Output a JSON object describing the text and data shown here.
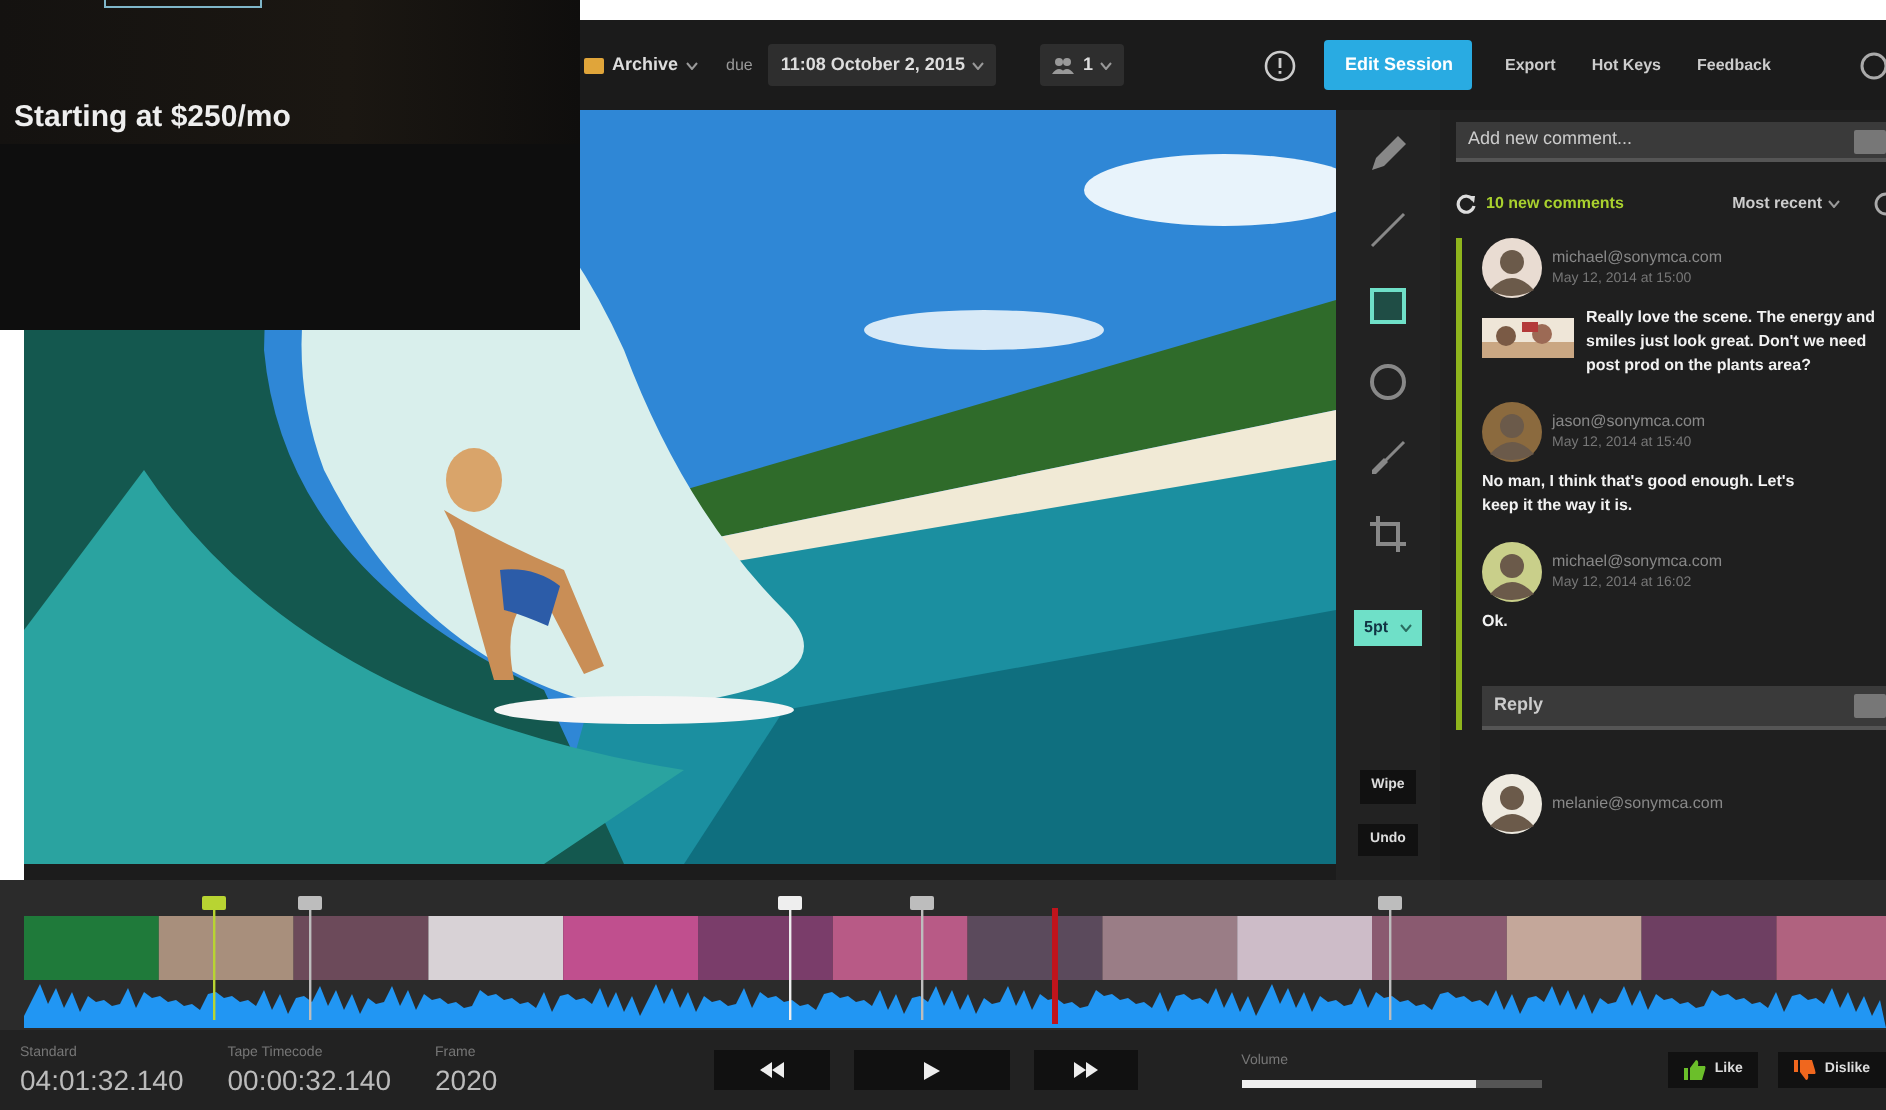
{
  "promo": {
    "price_text": "Starting at $250/mo"
  },
  "toolbar": {
    "project": "Archive",
    "due_label": "due",
    "due_date": "11:08 October 2, 2015",
    "viewers": "1",
    "edit_button": "Edit Session",
    "links": [
      "Export",
      "Hot Keys",
      "Feedback"
    ]
  },
  "video": {
    "kind": "picture"
  },
  "tools": [
    {
      "kind": "pencil",
      "selected": false
    },
    {
      "kind": "line",
      "selected": false
    },
    {
      "kind": "rectangle",
      "selected": true
    },
    {
      "kind": "circle",
      "selected": false
    },
    {
      "kind": "brush",
      "selected": false
    },
    {
      "kind": "crop",
      "selected": false
    }
  ],
  "stroke_size": "5pt",
  "tool_buttons": [
    "Wipe",
    "Undo"
  ],
  "comments_panel": {
    "placeholder": "Add new comment...",
    "new_count": "10 new comments",
    "sort": "Most recent",
    "threads": [
      {
        "highlighted": true,
        "reply_placeholder": "Reply",
        "comments": [
          {
            "author": "michael@sonymca.com",
            "time": "May 12, 2014 at 15:00",
            "text": "Really love the scene. The energy and smiles just look great. Don't we need post prod on the plants area?",
            "has_attachment": true
          },
          {
            "author": "jason@sonymca.com",
            "time": "May 12, 2014 at 15:40",
            "text": "No man, I think that's good enough. Let's keep it the way it is.",
            "has_attachment": false
          },
          {
            "author": "michael@sonymca.com",
            "time": "May 12, 2014 at 16:02",
            "text": "Ok.",
            "has_attachment": false
          }
        ]
      },
      {
        "highlighted": false,
        "comments": [
          {
            "author": "melanie@sonymca.com",
            "has_attachment": false
          }
        ]
      }
    ]
  },
  "timeline": {
    "markers": [
      {
        "color": "#b8d432"
      },
      {
        "color": "#bdbdbd"
      },
      {
        "color": "#eeeeee"
      },
      {
        "color": "#bdbdbd"
      },
      {
        "color": "#bdbdbd"
      }
    ]
  },
  "readouts": [
    {
      "label": "Standard",
      "value": "04:01:32.140"
    },
    {
      "label": "Tape Timecode",
      "value": "00:00:32.140"
    },
    {
      "label": "Frame",
      "value": "2020"
    }
  ],
  "transport": [
    {
      "kind": "rewind"
    },
    {
      "kind": "play"
    },
    {
      "kind": "forward"
    }
  ],
  "volume": {
    "label": "Volume",
    "level": 0.78
  },
  "reactions": [
    {
      "kind": "like",
      "label": "Like"
    },
    {
      "kind": "dislike",
      "label": "Dislike"
    }
  ]
}
